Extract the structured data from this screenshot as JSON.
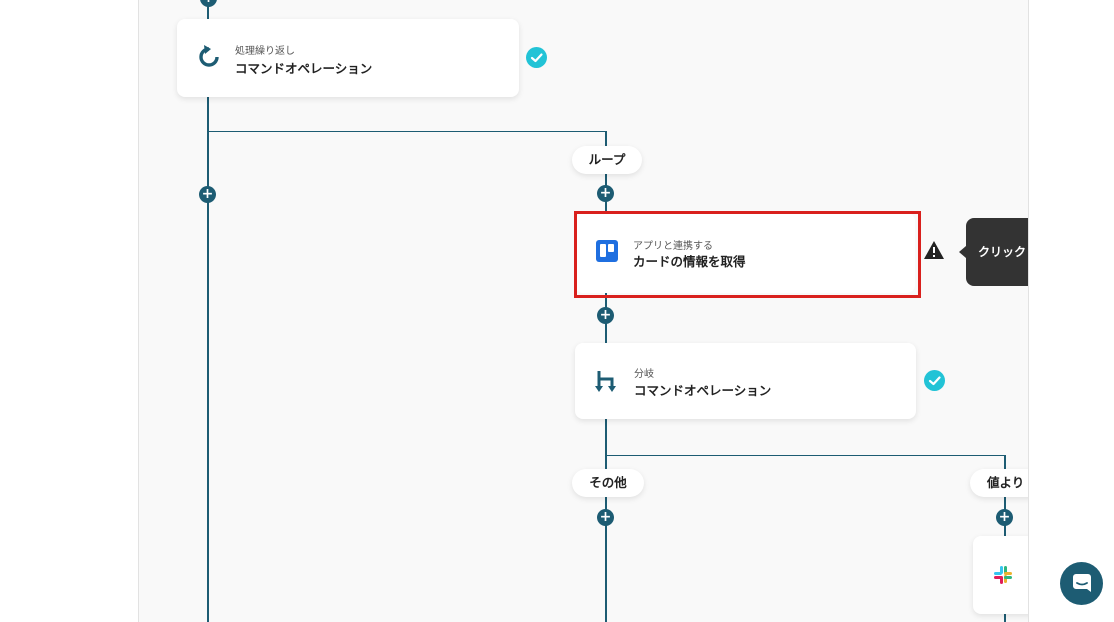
{
  "nodes": {
    "loop_op": {
      "category": "処理繰り返し",
      "title": "コマンドオペレーション"
    },
    "trello": {
      "category": "アプリと連携する",
      "title": "カードの情報を取得"
    },
    "branch_op": {
      "category": "分岐",
      "title": "コマンドオペレーション"
    }
  },
  "labels": {
    "loop": "ループ",
    "other": "その他",
    "branch_condition": "値より"
  },
  "tooltip": {
    "text": "クリックし"
  },
  "icons": {
    "loop_op": "refresh-icon",
    "trello": "trello-icon",
    "branch_op": "branch-icon",
    "slack": "slack-icon",
    "warning": "warning-icon",
    "check": "check-icon",
    "chat": "chat-icon"
  },
  "colors": {
    "line": "#1d5c73",
    "check": "#22c3d6",
    "highlight": "#d9201d",
    "trello": "#1f6fe0",
    "tooltip_bg": "#333333"
  }
}
